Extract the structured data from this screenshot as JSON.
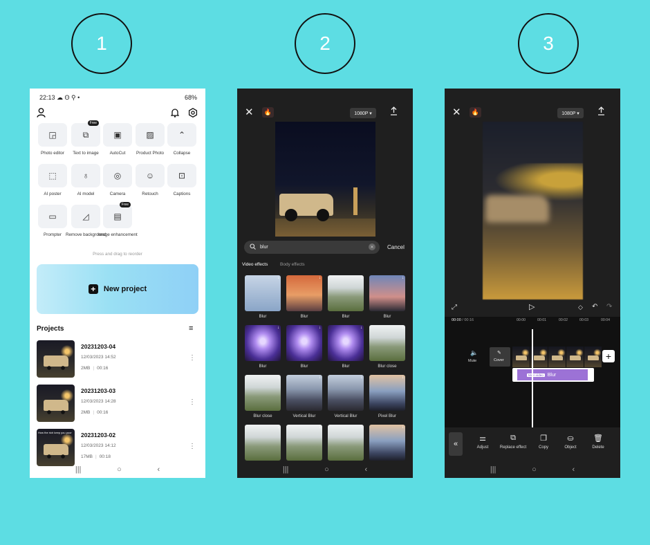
{
  "steps": [
    "1",
    "2",
    "3"
  ],
  "phone1": {
    "status": {
      "time": "22:13",
      "left_icons": "☁ ʘ ⚲ •",
      "right_text": "68%"
    },
    "tools": [
      {
        "label": "Photo editor",
        "icon": "◲"
      },
      {
        "label": "Text to image",
        "icon": "⧉",
        "badge": "Free"
      },
      {
        "label": "AutoCut",
        "icon": "▣"
      },
      {
        "label": "Product Photo",
        "icon": "▨"
      },
      {
        "label": "Collapse",
        "icon": "⌃"
      },
      {
        "label": "AI poster",
        "icon": "⬚"
      },
      {
        "label": "AI model",
        "icon": "♁"
      },
      {
        "label": "Camera",
        "icon": "◎"
      },
      {
        "label": "Retouch",
        "icon": "☺"
      },
      {
        "label": "Captions",
        "icon": "⊡"
      },
      {
        "label": "Prompter",
        "icon": "▭"
      },
      {
        "label": "Remove background",
        "icon": "◿"
      },
      {
        "label": "Image enhancement",
        "icon": "▤",
        "badge": "Free"
      }
    ],
    "reorder_hint": "Press and drag to reorder",
    "new_project": "New project",
    "projects_title": "Projects",
    "projects": [
      {
        "name": "20231203-04",
        "date": "12/03/2023 14:52",
        "size": "2MB",
        "duration": "00:16"
      },
      {
        "name": "20231203-03",
        "date": "12/03/2023 14:28",
        "size": "2MB",
        "duration": "00:16"
      },
      {
        "name": "20231203-02",
        "date": "12/03/2023 14:12",
        "size": "17MB",
        "duration": "00:18",
        "thumb_caption": "How the rich keep you poor"
      }
    ],
    "nav": [
      "|||",
      "○",
      "‹"
    ]
  },
  "phone2": {
    "resolution": "1080P ▾",
    "search_value": "blur",
    "cancel": "Cancel",
    "tabs": [
      "Video effects",
      "Body effects"
    ],
    "effects": [
      {
        "label": "Blur",
        "style": "eff-person"
      },
      {
        "label": "Blur",
        "style": "eff-sunset"
      },
      {
        "label": "Blur",
        "style": "eff-field"
      },
      {
        "label": "Blur",
        "style": "eff-blue"
      },
      {
        "label": "Blur",
        "style": "eff-purple"
      },
      {
        "label": "Blur",
        "style": "eff-purple"
      },
      {
        "label": "Blur",
        "style": "eff-purple"
      },
      {
        "label": "Blur close",
        "style": "eff-field"
      },
      {
        "label": "Blur close",
        "style": "eff-field"
      },
      {
        "label": "Vertical Blur",
        "style": "eff-city"
      },
      {
        "label": "Vertical Blur",
        "style": "eff-city"
      },
      {
        "label": "Pixel Blur",
        "style": "eff-dusk"
      },
      {
        "label": "",
        "style": "eff-field"
      },
      {
        "label": "",
        "style": "eff-field"
      },
      {
        "label": "",
        "style": "eff-field"
      },
      {
        "label": "",
        "style": "eff-dusk"
      }
    ],
    "nav": [
      "|||",
      "○",
      "‹"
    ]
  },
  "phone3": {
    "resolution": "1080P ▾",
    "time_current": "00:00",
    "time_total": "/ 00:16",
    "ticks": [
      "00:00",
      "00:01",
      "00:02",
      "00:03",
      "00:04"
    ],
    "mute": "Mute",
    "cover": "Cover",
    "effect_tag": "Main video",
    "effect_name": "Blur",
    "tools": [
      {
        "label": "Adjust",
        "icon": "⚌"
      },
      {
        "label": "Replace effect",
        "icon": "⧉"
      },
      {
        "label": "Copy",
        "icon": "❐"
      },
      {
        "label": "Object",
        "icon": "⛀"
      },
      {
        "label": "Delete",
        "icon": "🗑"
      }
    ],
    "nav": [
      "|||",
      "○",
      "‹"
    ]
  }
}
